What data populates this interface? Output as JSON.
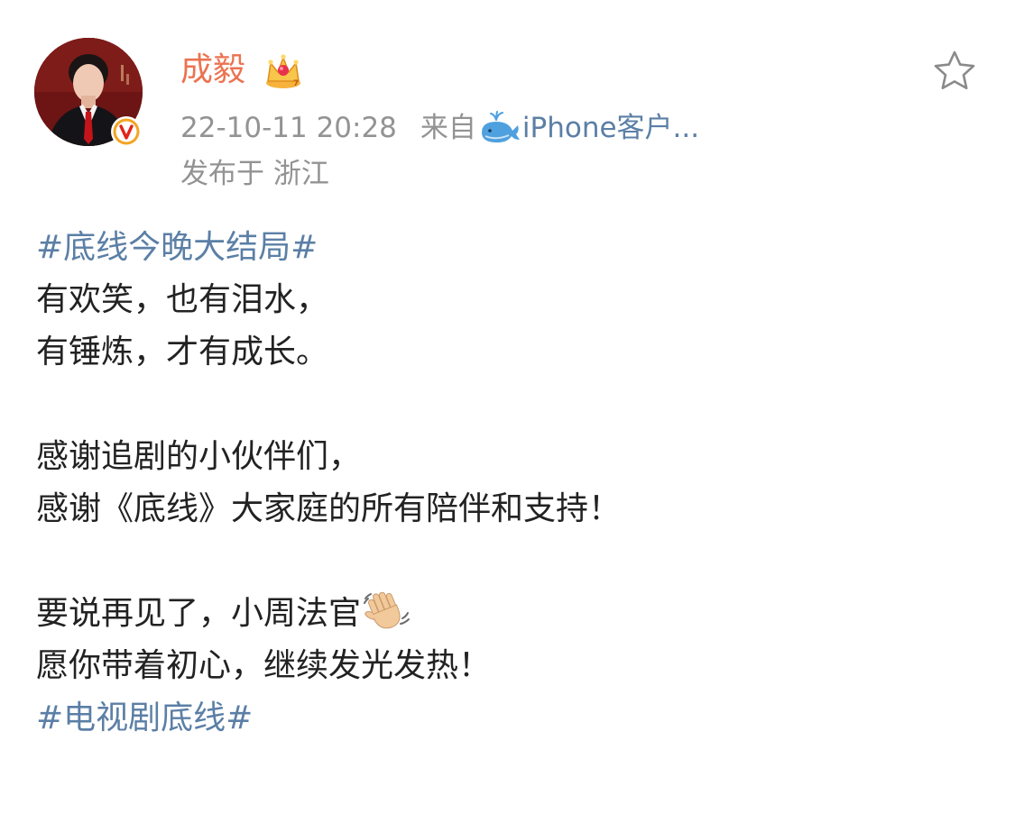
{
  "post": {
    "author": {
      "name": "成毅"
    },
    "meta": {
      "timestamp": "22-10-11 20:28",
      "source_prefix": "来自",
      "source": "iPhone客户...",
      "location": "发布于 浙江"
    },
    "content": {
      "hashtag_top": "#底线今晚大结局#",
      "line_1": "有欢笑，也有泪水，",
      "line_2": "有锤炼，才有成长。",
      "line_3": "感谢追剧的小伙伴们，",
      "line_4": "感谢《底线》大家庭的所有陪伴和支持！",
      "line_5": "要说再见了，小周法官",
      "line_6": "愿你带着初心，继续发光发热！",
      "hashtag_bottom": "#电视剧底线#"
    },
    "icons": {
      "avatar": "user-photo",
      "verified": "verified-v-badge",
      "crown": "crown-icon",
      "whale": "weibo-whale-icon",
      "wave": "waving-hand-emoji",
      "favorite": "star-outline-icon"
    },
    "colors": {
      "name": "#eb7350",
      "meta": "#939393",
      "link": "#5b7fa6",
      "text": "#222222",
      "verified": "#f3a423"
    }
  }
}
